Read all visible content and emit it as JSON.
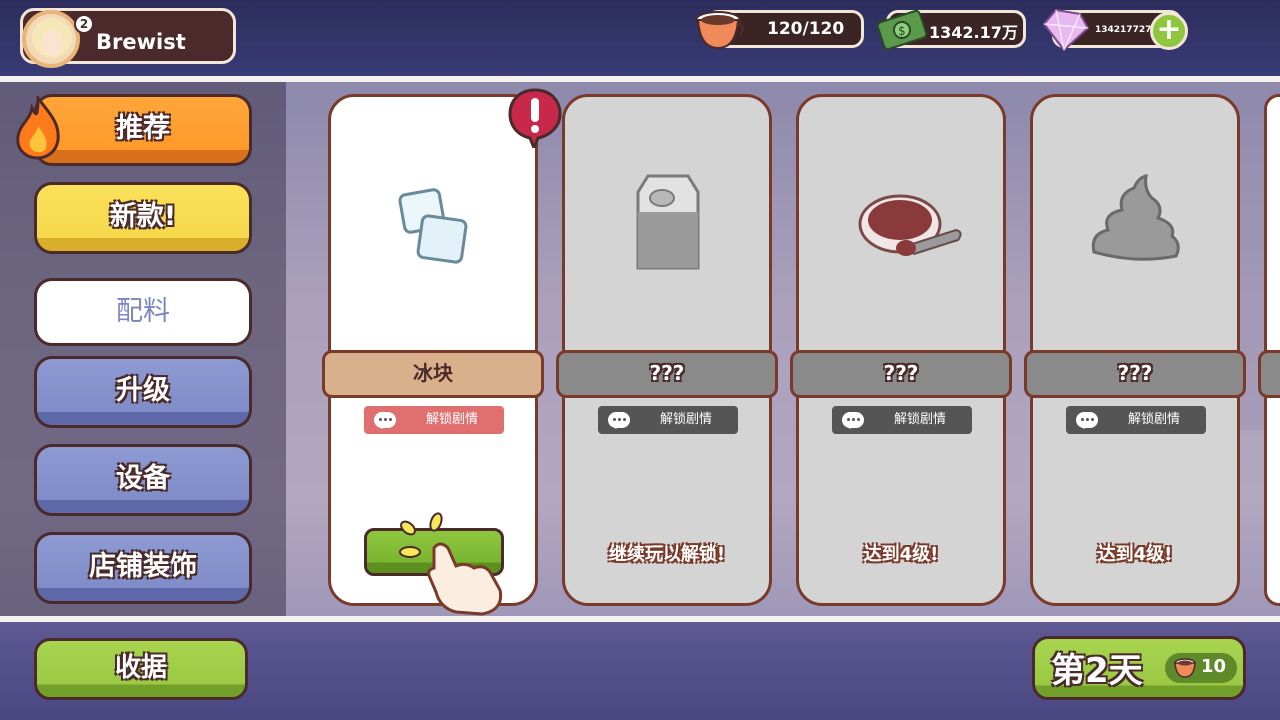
{
  "player": {
    "name": "Brewist",
    "level": "2"
  },
  "resources": {
    "coffee": "120/120",
    "cash": "1342.17万",
    "gems": "1342177279"
  },
  "sidebar": {
    "items": [
      {
        "label": "推荐"
      },
      {
        "label": "新款!"
      },
      {
        "label": "配料"
      },
      {
        "label": "升级"
      },
      {
        "label": "设备"
      },
      {
        "label": "店铺装饰"
      }
    ]
  },
  "cards": [
    {
      "name": "冰块",
      "story": "解锁剧情",
      "icon": "ice-cubes-icon"
    },
    {
      "name": "???",
      "story": "解锁剧情",
      "unlock": "继续玩以解锁!",
      "icon": "milk-carton-icon"
    },
    {
      "name": "???",
      "story": "解锁剧情",
      "unlock": "达到4级!",
      "icon": "red-bean-bowl-icon"
    },
    {
      "name": "???",
      "story": "解锁剧情",
      "unlock": "达到4级!",
      "icon": "cream-swirl-icon"
    }
  ],
  "buttons": {
    "collect": "收据"
  },
  "day": {
    "label": "第2天",
    "cups": "10"
  },
  "colors": {
    "accent": "#8ec63f",
    "border": "#4a2a2a",
    "orange": "#ffa63a"
  }
}
